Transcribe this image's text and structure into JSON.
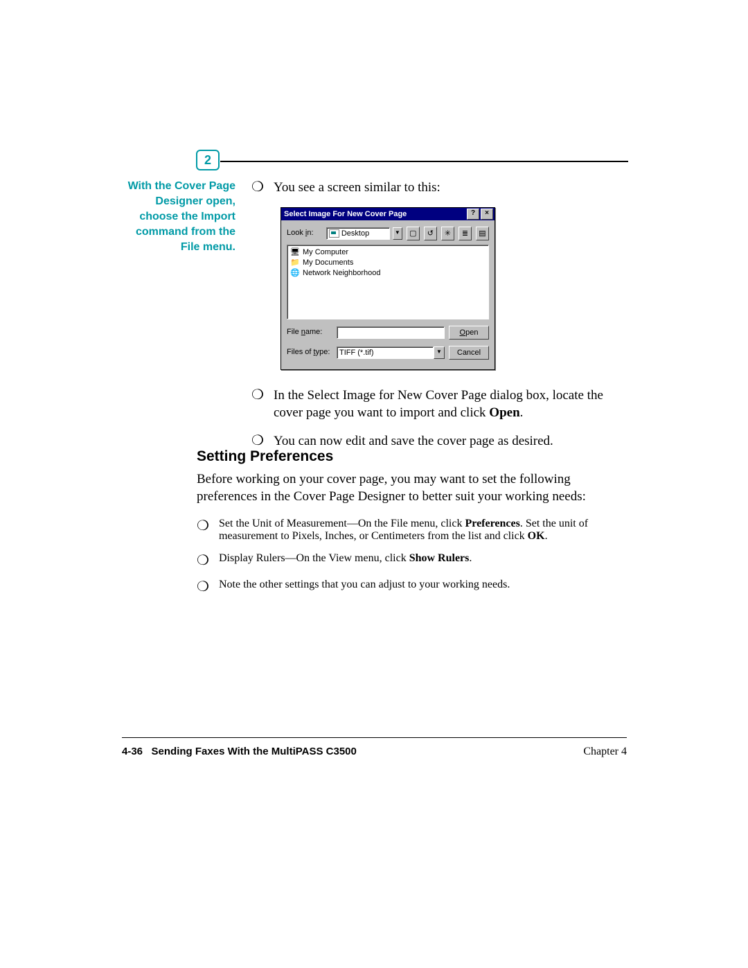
{
  "step_badge": "2",
  "sidebar_note": "With the Cover Page Designer open, choose the Import command from the File menu.",
  "bullets_top": [
    {
      "lead": "You see a screen similar to this:"
    }
  ],
  "dialog": {
    "title": "Select Image For New Cover Page",
    "help_glyph": "?",
    "close_glyph": "×",
    "lookin_label_pre": "Look ",
    "lookin_label_u": "i",
    "lookin_label_post": "n:",
    "lookin_value": "Desktop",
    "dd_glyph": "▼",
    "toolbar_icons": [
      "▢",
      "↺",
      "✳",
      "≣",
      "▤"
    ],
    "list_items": [
      {
        "icon": "🖥",
        "label": "My Computer"
      },
      {
        "icon": "📁",
        "label": "My Documents"
      },
      {
        "icon": "🌐",
        "label": "Network Neighborhood"
      }
    ],
    "filename_label_pre": "File ",
    "filename_label_u": "n",
    "filename_label_post": "ame:",
    "filename_value": "",
    "filetype_label_pre": "Files of ",
    "filetype_label_u": "t",
    "filetype_label_post": "ype:",
    "filetype_value": "TIFF (*.tif)",
    "open_u": "O",
    "open_rest": "pen",
    "cancel": "Cancel"
  },
  "bullets_after_dialog": [
    {
      "pre": "In the Select Image for New Cover Page dialog box, locate the cover page you want to import and click ",
      "b1": "Open",
      "post": "."
    },
    {
      "pre": "You can now edit and save the cover page as desired."
    }
  ],
  "section_heading": "Setting Preferences",
  "section_intro": "Before working on your cover page, you may want to set the following preferences in the Cover Page Designer to better suit your working needs:",
  "section_bullets": [
    {
      "pre": "Set the Unit of Measurement—On the File menu, click ",
      "b1": "Preferences",
      "mid": ". Set the unit of measurement to Pixels, Inches, or Centimeters from the list and click ",
      "b2": "OK",
      "post": "."
    },
    {
      "pre": "Display Rulers—On the View menu, click ",
      "b1": "Show Rulers",
      "post": "."
    },
    {
      "pre": "Note the other settings that you can adjust to your working needs."
    }
  ],
  "footer": {
    "page_num": "4-36",
    "section_title": "Sending Faxes With the MultiPASS C3500",
    "chapter": "Chapter 4"
  },
  "bullet_glyph": "❍"
}
